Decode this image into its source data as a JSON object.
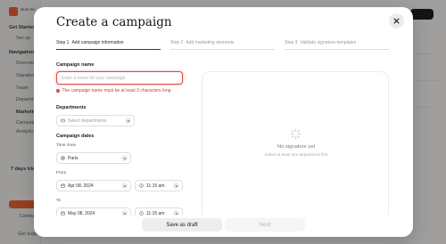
{
  "background": {
    "org_name": "Nust Inc",
    "items": [
      "Get Started",
      "Set up",
      "Navigation",
      "Overview",
      "Signatures",
      "Team",
      "Departments",
      "Marketing",
      "Campaigns",
      "Analytics"
    ],
    "trial_text": "7 days trial",
    "contact_label": "Contact",
    "get_support": "Get support"
  },
  "modal": {
    "title": "Create a campaign",
    "steps": [
      {
        "num": "Step 1",
        "label": "Add campaign information",
        "active": true
      },
      {
        "num": "Step 2",
        "label": "Add marketing elements",
        "active": false
      },
      {
        "num": "Step 3",
        "label": "Validate signature templates",
        "active": false
      }
    ],
    "form": {
      "name_label": "Campaign name",
      "name_value": "",
      "name_placeholder": "Enter a name for your campaign",
      "name_error": "The campaign name must be at least 3 characters long",
      "departments_label": "Departments",
      "departments_placeholder": "Select departments",
      "dates_label": "Campaign dates",
      "timezone_label": "Time zone",
      "timezone_value": "Paris",
      "from_label": "From",
      "from_date": "Apr 08, 2024",
      "from_time": "11:15 am",
      "to_label": "To",
      "to_date": "May 08, 2024",
      "to_time": "11:15 am"
    },
    "preview": {
      "title": "No signature yet",
      "subtitle": "Select at least one department first"
    },
    "footer": {
      "save_draft": "Save as draft",
      "next": "Next"
    }
  },
  "colors": {
    "error": "#d93636",
    "overlay": "rgba(20,20,20,0.38)",
    "accent": "#e85a2a"
  }
}
